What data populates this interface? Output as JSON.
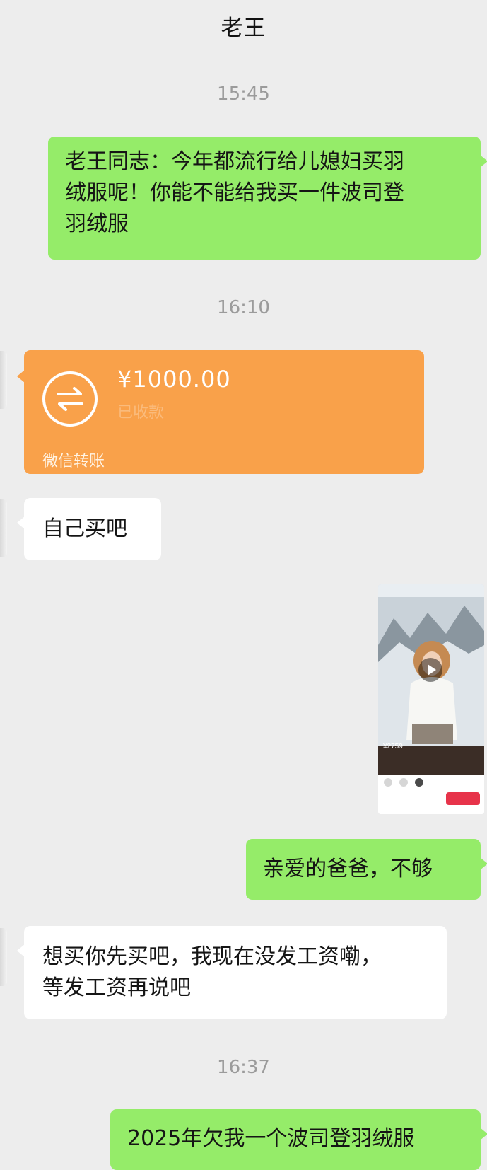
{
  "header": {
    "title": "老王"
  },
  "messages": [
    {
      "type": "timestamp",
      "text": "15:45"
    },
    {
      "type": "text",
      "side": "right",
      "lines": [
        "老王同志：今年都流行给儿媳妇买羽",
        "绒服呢！你能不能给我买一件波司登",
        "羽绒服"
      ]
    },
    {
      "type": "timestamp",
      "text": "16:10"
    },
    {
      "type": "transfer",
      "side": "left",
      "amount": "¥1000.00",
      "note": "已收款",
      "label": "微信转账"
    },
    {
      "type": "text",
      "side": "left",
      "lines": [
        "自己买吧"
      ]
    },
    {
      "type": "video",
      "side": "right",
      "thumbnail": "winter-jacket-product-video",
      "price": "¥2759"
    },
    {
      "type": "text",
      "side": "right",
      "lines": [
        "亲爱的爸爸，不够"
      ]
    },
    {
      "type": "text",
      "side": "left",
      "lines": [
        "想买你先买吧，我现在没发工资嘞，",
        "等发工资再说吧"
      ]
    },
    {
      "type": "timestamp",
      "text": "16:37"
    },
    {
      "type": "text",
      "side": "right",
      "lines": [
        "2025年欠我一个波司登羽绒服"
      ]
    }
  ],
  "colors": {
    "background": "#ededed",
    "bubble_right": "#95ec69",
    "bubble_left": "#ffffff",
    "transfer": "#f9a14a",
    "timestamp": "#9b9b9b"
  },
  "icons": {
    "transfer": "transfer-arrows-icon",
    "play": "play-icon"
  }
}
